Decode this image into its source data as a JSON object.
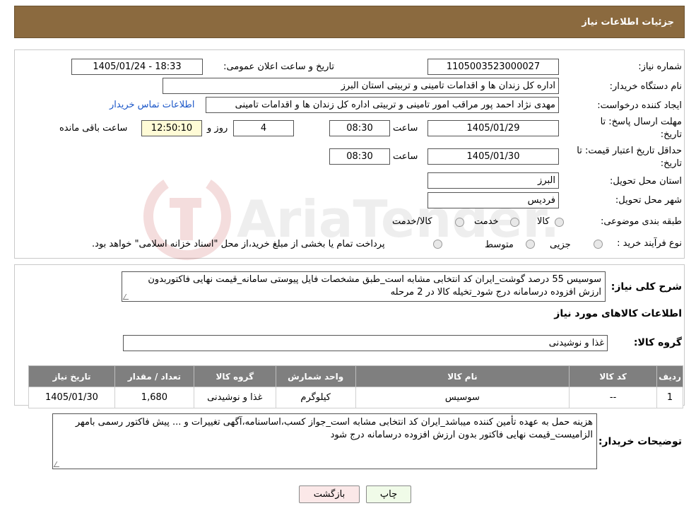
{
  "header": {
    "title": "جزئیات اطلاعات نیاز"
  },
  "fields": {
    "need_number_label": "شماره نیاز:",
    "need_number": "1105003523000027",
    "announce_label": "تاریخ و ساعت اعلان عمومی:",
    "announce_value": "1405/01/24 - 18:33",
    "buyer_org_label": "نام دستگاه خریدار:",
    "buyer_org": "اداره کل زندان ها و اقدامات تامینی و تربیتی استان البرز",
    "creator_label": "ایجاد کننده درخواست:",
    "creator": "مهدی نژاد احمد پور مراقب امور تامینی و تربیتی اداره کل زندان ها و اقدامات تامینی",
    "contact_link": "اطلاعات تماس خریدار",
    "deadline_label_1": "مهلت ارسال پاسخ: تا",
    "deadline_label_2": "تاریخ:",
    "deadline_date": "1405/01/29",
    "time_label": "ساعت",
    "deadline_time": "08:30",
    "days_value": "4",
    "days_label": "روز و",
    "remaining_time": "12:50:10",
    "remaining_label": "ساعت باقی مانده",
    "validity_label_1": "حداقل تاریخ اعتبار قیمت: تا",
    "validity_label_2": "تاریخ:",
    "validity_date": "1405/01/30",
    "validity_time": "08:30",
    "province_label": "استان محل تحویل:",
    "province": "البرز",
    "city_label": "شهر محل تحویل:",
    "city": "فردیس",
    "category_label": "طبقه بندی موضوعی:",
    "category_options": [
      "کالا",
      "خدمت",
      "کالا/خدمت"
    ],
    "process_label": "نوع فرآیند خرید :",
    "process_options": [
      "جزیی",
      "متوسط"
    ],
    "process_note": "پرداخت تمام یا بخشی از مبلغ خرید،از محل \"اسناد خزانه اسلامی\" خواهد بود."
  },
  "description": {
    "label": "شرح کلی نیاز:",
    "text": "سوسیس 55 درصد گوشت_ایران کد انتخابی مشابه است_طبق مشخصات فایل پیوستی سامانه_قیمت نهایی فاکتوربدون ارزش افزوده درسامانه درج شود_تخیله کالا در 2 مرحله"
  },
  "goods_section": {
    "title": "اطلاعات کالاهای مورد نیاز",
    "group_label": "گروه کالا:",
    "group_value": "غذا و نوشیدنی"
  },
  "table": {
    "headers": [
      "ردیف",
      "کد کالا",
      "نام کالا",
      "واحد شمارش",
      "گروه کالا",
      "تعداد / مقدار",
      "تاریخ نیاز"
    ],
    "rows": [
      [
        "1",
        "--",
        "سوسیس",
        "کیلوگرم",
        "غذا و نوشیدنی",
        "1,680",
        "1405/01/30"
      ]
    ]
  },
  "buyer_notes": {
    "label": "توضیحات خریدار:",
    "text": "هزینه حمل به عهده تأمین کننده میباشد_ایران کد انتخابی مشابه است_جواز کسب،اساسنامه،آگهی تغییرات و ... پیش فاکتور رسمی بامهر الزامیست_قیمت نهایی فاکتور بدون ارزش افزوده درسامانه درج شود"
  },
  "buttons": {
    "print": "چاپ",
    "back": "بازگشت"
  },
  "colors": {
    "header_bg": "#8b6a3f",
    "table_header_bg": "#7f7f7f",
    "link": "#1a56c8"
  },
  "watermark": {
    "text": "AriaTender.neT"
  }
}
